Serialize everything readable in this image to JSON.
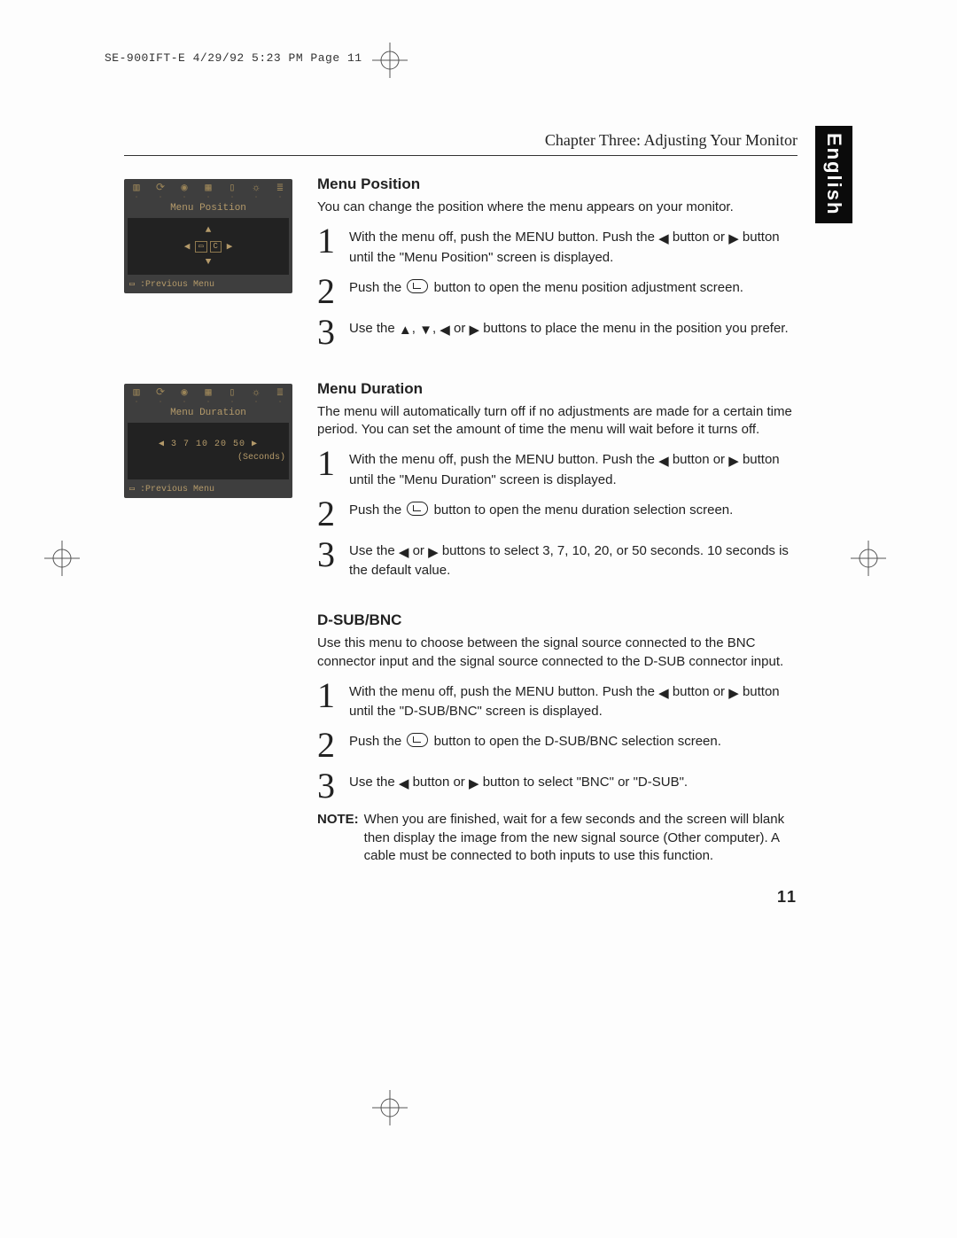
{
  "slug": "SE-900IFT-E  4/29/92 5:23 PM  Page 11",
  "chapter": "Chapter Three: Adjusting Your Monitor",
  "languageTab": "English",
  "pageNumber": "11",
  "glyphs": {
    "left": "◀",
    "right": "▶",
    "up": "▲",
    "down": "▼",
    "menuIcon": "▭"
  },
  "osd": {
    "position": {
      "title": "Menu Position",
      "footer": ":Previous Menu",
      "centerBtn": "▭",
      "cancelBtn": "C"
    },
    "duration": {
      "title": "Menu Duration",
      "values": "3  7  10  20  50",
      "unit": "(Seconds)",
      "footer": ":Previous Menu"
    }
  },
  "s1": {
    "title": "Menu Position",
    "intro": "You can change the position where the menu appears on your monitor.",
    "step1a": "With the menu off, push the MENU button. Push the",
    "step1b": "button or",
    "step1c": "button until the \"Menu Position\" screen is displayed.",
    "step2a": "Push the",
    "step2b": "button to open the menu position adjustment screen.",
    "step3a": "Use the",
    "step3b": "or",
    "step3c": "buttons to place the menu in the position you prefer."
  },
  "s2": {
    "title": "Menu Duration",
    "intro": "The menu will automatically turn off if no adjustments are made for a certain time period. You can set the amount of time the menu will wait before it turns off.",
    "step1a": "With the menu off, push the MENU button.",
    "step1b": "Push the",
    "step1c": "button or",
    "step1d": "button until the \"Menu Duration\" screen is displayed.",
    "step2a": "Push the",
    "step2b": "button to open the menu duration selection screen.",
    "step3a": "Use the",
    "step3b": "or",
    "step3c": "buttons to select 3, 7, 10, 20, or 50 seconds. 10 seconds is the default value."
  },
  "s3": {
    "title": "D-SUB/BNC",
    "intro": "Use this menu to choose between the signal source connected to the BNC connector input and the signal source connected to the D-SUB connector input.",
    "step1a": "With the menu off, push the MENU button.",
    "step1b": "Push the",
    "step1c": "button or",
    "step1d": "button until the \"D-SUB/BNC\" screen is displayed.",
    "step2a": "Push the",
    "step2b": "button to open the D-SUB/BNC selection screen.",
    "step3a": "Use the",
    "step3b": "button or",
    "step3c": "button to select \"BNC\" or \"D-SUB\".",
    "noteLabel": "NOTE:",
    "noteText": "When you are finished, wait for a few seconds and the screen will blank then display the image from the new signal source (Other computer). A cable must be connected to both inputs to use this function."
  }
}
